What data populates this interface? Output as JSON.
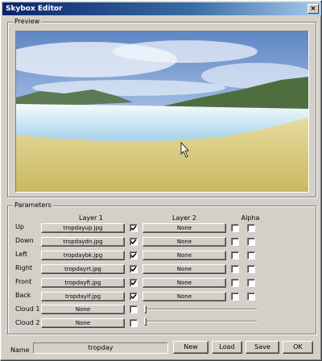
{
  "window": {
    "title": "Skybox Editor",
    "close_label": "×"
  },
  "preview": {
    "group_label": "Preview"
  },
  "parameters": {
    "group_label": "Parameters",
    "headers": {
      "layer1": "Layer 1",
      "layer2": "Layer 2",
      "alpha": "Alpha"
    },
    "rows": [
      {
        "label": "Up",
        "layer1": "tropdayup.jpg",
        "layer1_checked": true,
        "layer2": "None",
        "layer2_checked": false,
        "alpha": false
      },
      {
        "label": "Down",
        "layer1": "tropdaydn.jpg",
        "layer1_checked": true,
        "layer2": "None",
        "layer2_checked": false,
        "alpha": false
      },
      {
        "label": "Left",
        "layer1": "tropdaybk.jpg",
        "layer1_checked": true,
        "layer2": "None",
        "layer2_checked": false,
        "alpha": false
      },
      {
        "label": "Right",
        "layer1": "tropdayrt.jpg",
        "layer1_checked": true,
        "layer2": "None",
        "layer2_checked": false,
        "alpha": false
      },
      {
        "label": "Front",
        "layer1": "tropdayft.jpg",
        "layer1_checked": true,
        "layer2": "None",
        "layer2_checked": false,
        "alpha": false
      },
      {
        "label": "Back",
        "layer1": "tropdaylf.jpg",
        "layer1_checked": true,
        "layer2": "None",
        "layer2_checked": false,
        "alpha": false
      }
    ],
    "clouds": [
      {
        "label": "Cloud 1",
        "texture": "None",
        "checked": false,
        "slider_value": 0
      },
      {
        "label": "Cloud 2",
        "texture": "None",
        "checked": false,
        "slider_value": 0
      }
    ]
  },
  "footer": {
    "name_label": "Name",
    "name_value": "tropday",
    "new_label": "New",
    "load_label": "Load",
    "save_label": "Save",
    "ok_label": "OK"
  }
}
